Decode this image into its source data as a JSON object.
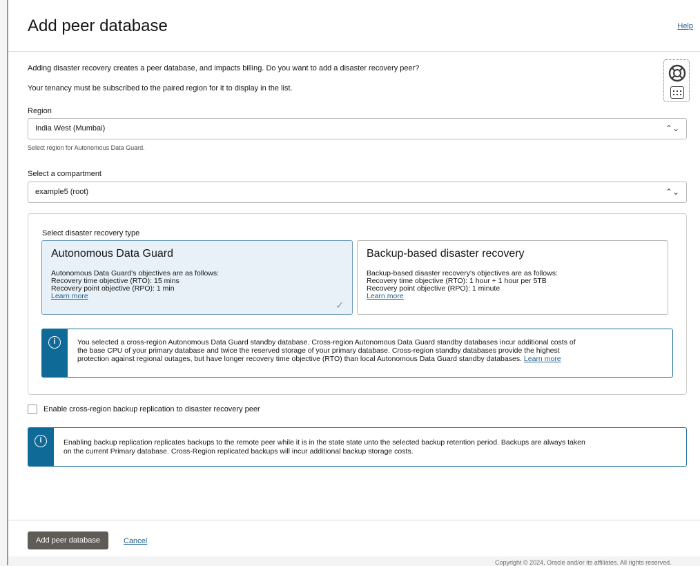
{
  "header": {
    "title": "Add peer database",
    "help_label": "Help"
  },
  "intro": {
    "line1": "Adding disaster recovery creates a peer database, and impacts billing. Do you want to add a disaster recovery peer?",
    "line2": "Your tenancy must be subscribed to the paired region for it to display in the list."
  },
  "region": {
    "label": "Region",
    "value": "India West (Mumbai)",
    "hint": "Select region for Autonomous Data Guard."
  },
  "compartment": {
    "label": "Select a compartment",
    "value": "example5 (root)"
  },
  "dr_type": {
    "label": "Select disaster recovery type",
    "selected": "Autonomous Data Guard",
    "options": [
      {
        "title": "Autonomous Data Guard",
        "lines": [
          "Autonomous Data Guard's objectives are as follows:",
          "Recovery time objective (RTO): 15 mins",
          "Recovery point objective (RPO): 1 min"
        ],
        "link": "Learn more"
      },
      {
        "title": "Backup-based disaster recovery",
        "lines": [
          "Backup-based disaster recovery's objectives are as follows:",
          "Recovery time objective (RTO): 1 hour + 1 hour per 5TB",
          "Recovery point objective (RPO): 1 minute"
        ],
        "link": "Learn more"
      }
    ],
    "info": {
      "line1": "You selected a cross-region Autonomous Data Guard standby database. Cross-region Autonomous Data Guard standby databases incur additional costs of",
      "line2": "the base CPU of your primary database and twice the reserved storage of your primary database. Cross-region standby databases provide the highest",
      "line3": "protection against regional outages, but have longer recovery time objective (RTO) than local Autonomous Data Guard standby databases.",
      "link": "Learn more"
    }
  },
  "backup_replication": {
    "checkbox_label": "Enable cross-region backup replication to disaster recovery peer",
    "checked": false,
    "info": {
      "line1": "Enabling backup replication replicates backups to the remote peer while it is in the state state unto the selected backup retention period. Backups are always taken",
      "line2": "on the current Primary database. Cross-Region replicated backups will incur additional backup storage costs."
    }
  },
  "footer": {
    "submit_label": "Add peer database",
    "cancel_label": "Cancel"
  },
  "copyright": "Copyright © 2024, Oracle and/or its affiliates. All rights reserved."
}
